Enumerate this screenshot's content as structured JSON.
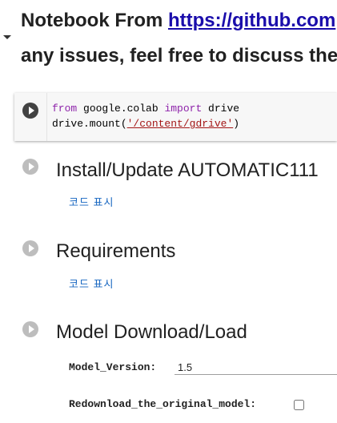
{
  "header": {
    "line1_prefix": "Notebook From ",
    "line1_link": "https://github.com",
    "line2": "any issues, feel free to discuss the"
  },
  "code_cell": {
    "line1": {
      "kw1": "from",
      "mod": " google.colab ",
      "kw2": "import",
      "rest": " drive"
    },
    "line2": {
      "prefix": "drive.mount(",
      "arg": "'/content/gdrive'",
      "suffix": ")"
    }
  },
  "sections": [
    {
      "title": "Install/Update AUTOMATIC111",
      "show_code": "코드 표시"
    },
    {
      "title": "Requirements",
      "show_code": "코드 표시"
    },
    {
      "title": "Model Download/Load"
    }
  ],
  "form": {
    "model_version_label": "Model_Version:",
    "model_version_value": "1.5",
    "redownload_label": "Redownload_the_original_model:",
    "redownload_checked": false
  }
}
